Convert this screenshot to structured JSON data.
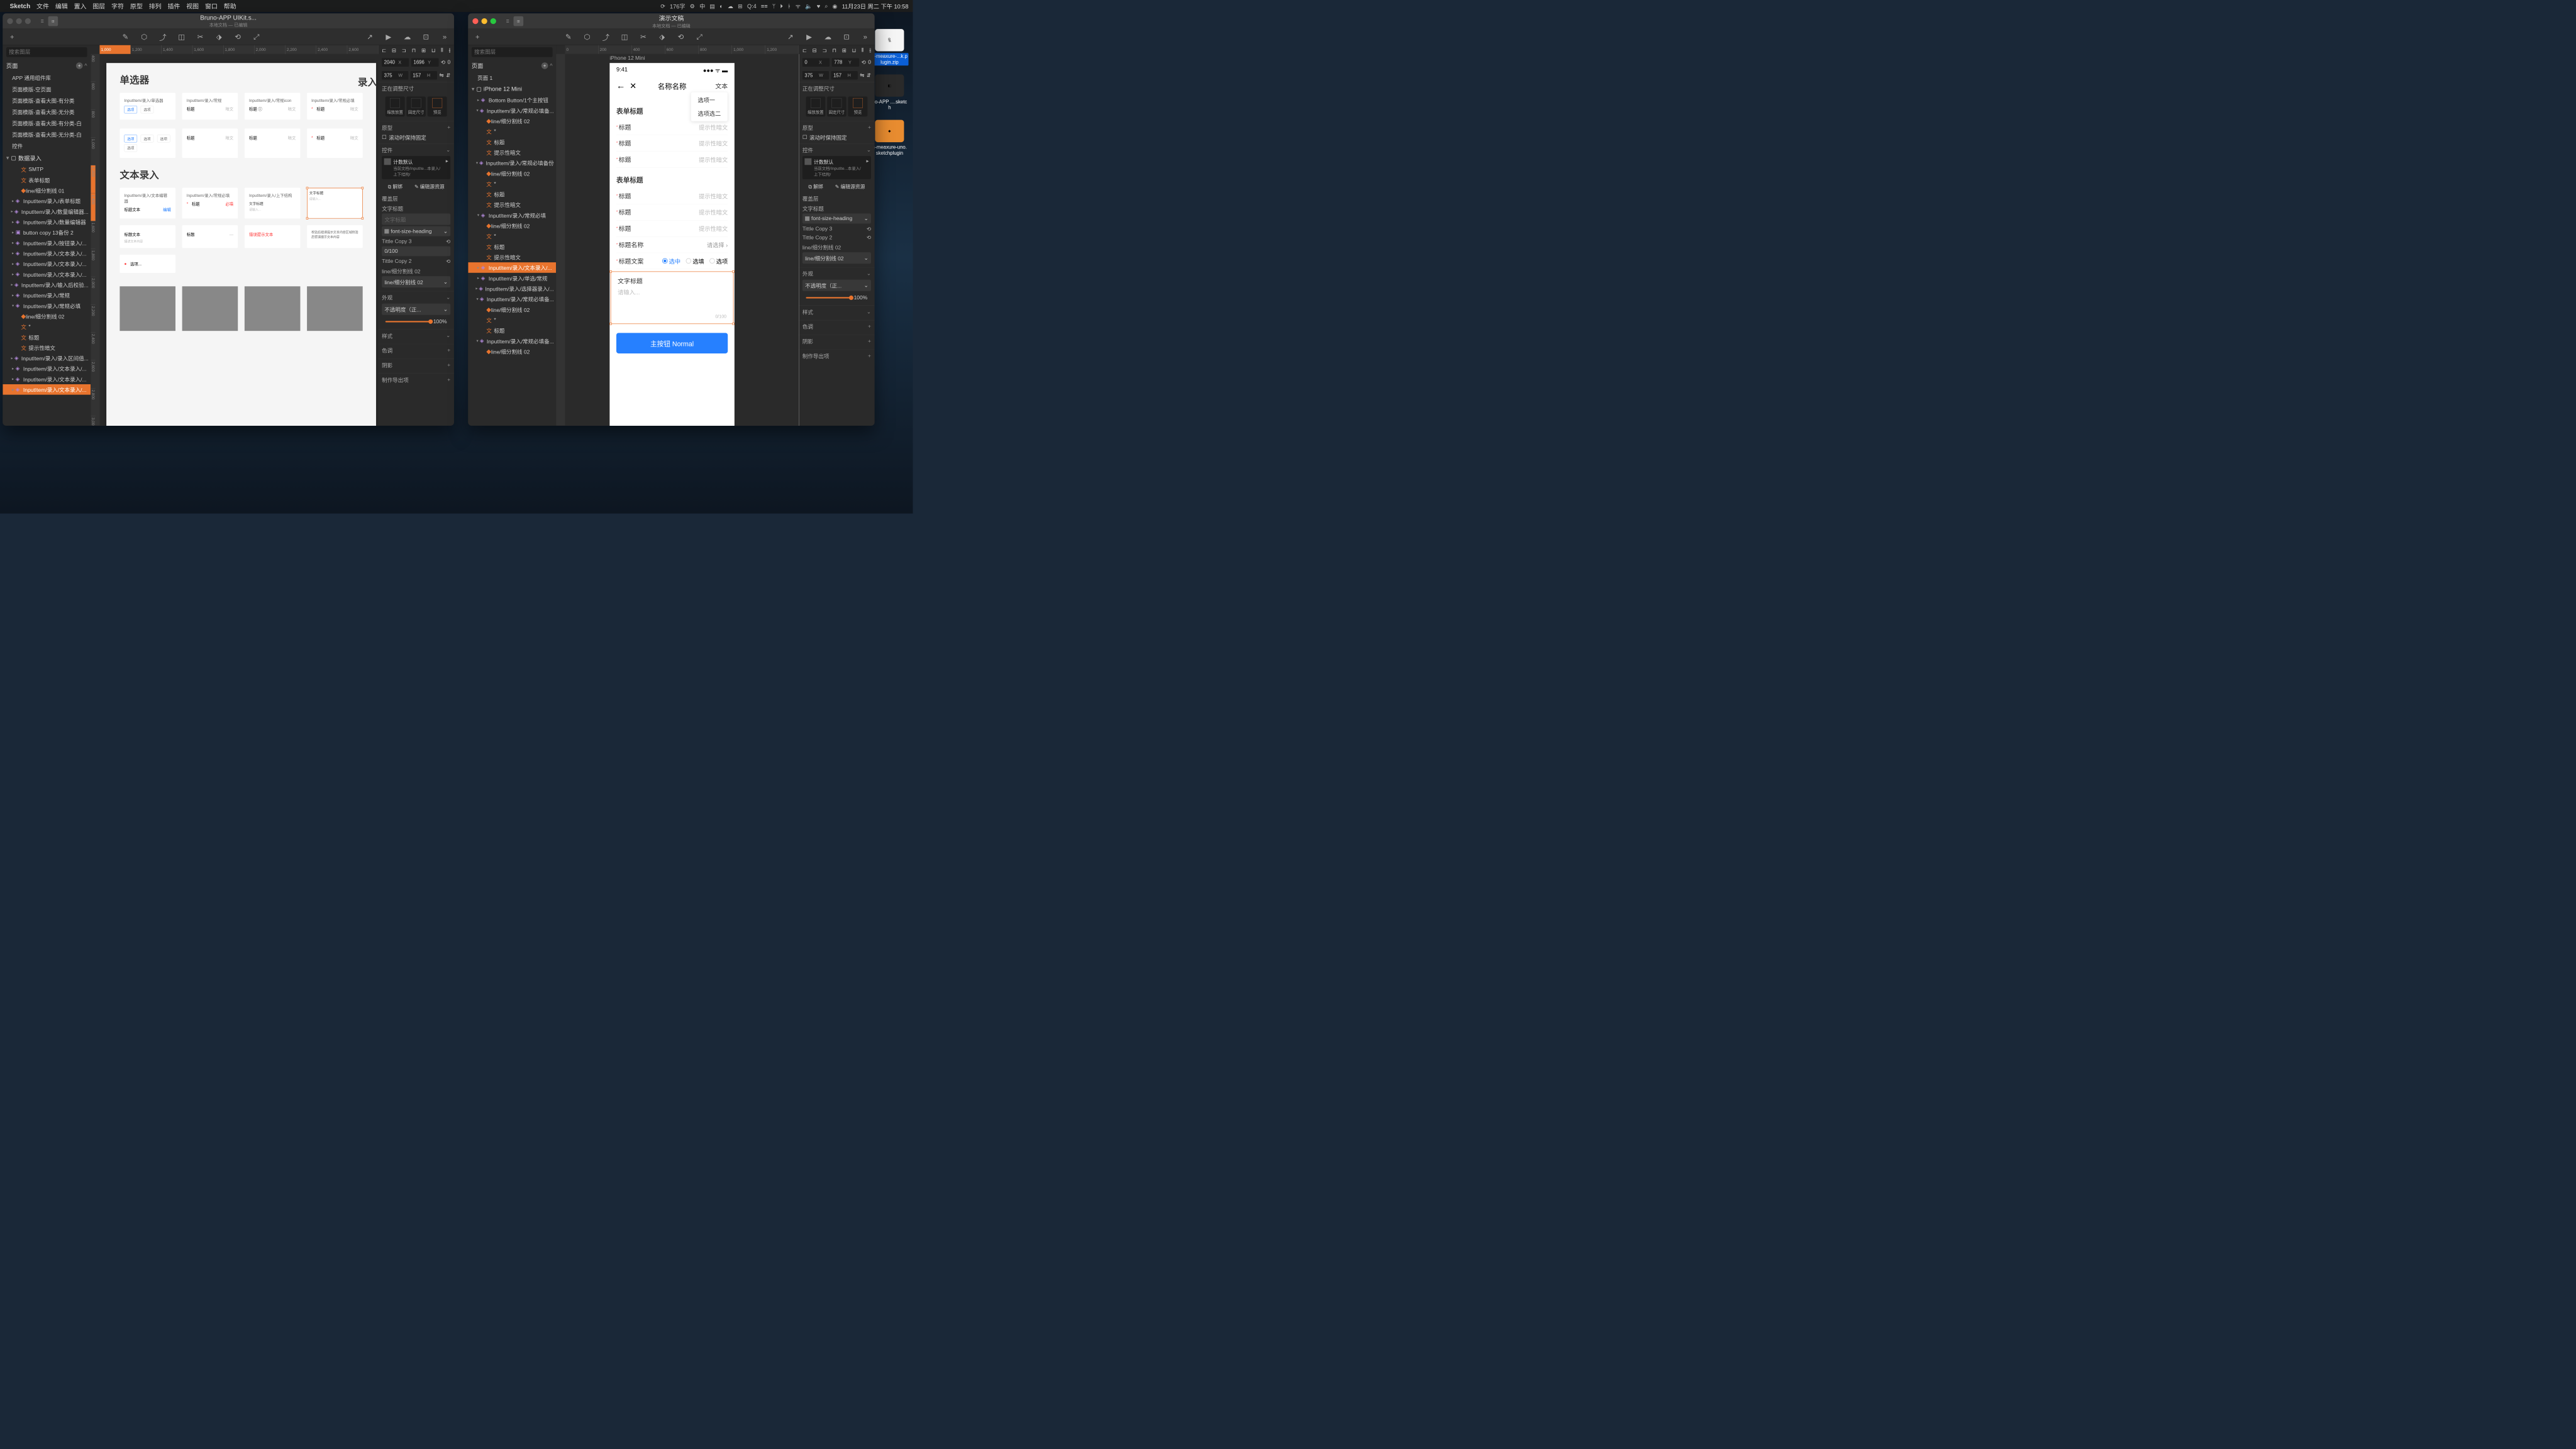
{
  "menubar": {
    "app": "Sketch",
    "items": [
      "文件",
      "编辑",
      "置入",
      "图层",
      "字符",
      "原型",
      "排列",
      "插件",
      "视图",
      "窗口",
      "帮助"
    ],
    "right": {
      "input_stat": "176字",
      "icons": [
        "⟳",
        "⚙",
        "中",
        "☰",
        "▣",
        "☁",
        "⊞",
        "Q:4",
        "≡",
        "ᛘ",
        "⏏",
        "⚡",
        "✶",
        "⊙",
        "ᯤ",
        "🔈",
        "♥",
        "⌕"
      ],
      "date": "11月23日 周二 下午 10:58"
    }
  },
  "desktop_icons": [
    {
      "name": "n-meaxure-...k.plugin.zip"
    },
    {
      "name": "no-APP ....sketch"
    },
    {
      "name": "n-meaxure-uno.sketchplugin"
    }
  ],
  "window_left": {
    "title": "Bruno-APP UIKit.s...",
    "subtitle": "本地文档 — 已编辑",
    "sidebar": {
      "search_ph": "搜索图层",
      "pages_head": "页面",
      "pages": [
        "APP 通用组件库",
        "页面模版-空页面",
        "页面模版-查看大图-有分类",
        "页面模版-查看大图-无分类",
        "页面模版-查看大图-有分类-白",
        "页面模版-查看大图-无分类-白",
        "控件"
      ],
      "layers_head": "数据录入",
      "layers": [
        {
          "t": "SMTP",
          "d": 2,
          "ic": "txt"
        },
        {
          "t": "表单标题",
          "d": 2,
          "ic": "txt"
        },
        {
          "t": "line/细分割线 01",
          "d": 2,
          "ic": "dot"
        },
        {
          "t": "InputItem/录入/表单标题",
          "d": 1,
          "ic": "sym",
          "chev": "▸"
        },
        {
          "t": "InputItem/录入/数量编辑器...",
          "d": 1,
          "ic": "sym",
          "chev": "▸"
        },
        {
          "t": "InputItem/录入/数量编辑器",
          "d": 1,
          "ic": "sym",
          "chev": "▸"
        },
        {
          "t": "button copy 13备份 2",
          "d": 1,
          "ic": "grp",
          "chev": "▸"
        },
        {
          "t": "InputItem/录入/按钮录入/...",
          "d": 1,
          "ic": "sym",
          "chev": "▸"
        },
        {
          "t": "InputItem/录入/文本录入/...",
          "d": 1,
          "ic": "sym",
          "chev": "▸"
        },
        {
          "t": "InputItem/录入/文本录入/...",
          "d": 1,
          "ic": "sym",
          "chev": "▸"
        },
        {
          "t": "InputItem/录入/文本录入/...",
          "d": 1,
          "ic": "sym",
          "chev": "▸"
        },
        {
          "t": "InputItem/录入/输入后校验...",
          "d": 1,
          "ic": "sym",
          "chev": "▸"
        },
        {
          "t": "InputItem/录入/常规",
          "d": 1,
          "ic": "sym",
          "chev": "▸"
        },
        {
          "t": "InputItem/录入/常规必填",
          "d": 1,
          "ic": "sym",
          "chev": "▾"
        },
        {
          "t": "line/细分割线 02",
          "d": 2,
          "ic": "dot"
        },
        {
          "t": "*",
          "d": 2,
          "ic": "txt"
        },
        {
          "t": "标题",
          "d": 2,
          "ic": "txt"
        },
        {
          "t": "提示性暗文",
          "d": 2,
          "ic": "txt"
        },
        {
          "t": "InputItem/录入/录入区间值...",
          "d": 1,
          "ic": "sym",
          "chev": "▸"
        },
        {
          "t": "InputItem/录入/文本录入/...",
          "d": 1,
          "ic": "sym",
          "chev": "▸"
        },
        {
          "t": "InputItem/录入/文本录入/...",
          "d": 1,
          "ic": "sym",
          "chev": "▸"
        },
        {
          "t": "InputItem/录入/文本录入/...",
          "d": 1,
          "ic": "sym",
          "chev": "▸",
          "sel": true
        }
      ]
    },
    "ruler_h": [
      "1,000",
      "1,200",
      "1,400",
      "1,600",
      "1,800",
      "2,000",
      "2,200",
      "2,400",
      "2,600"
    ],
    "ruler_v": [
      "400",
      "600",
      "800",
      "1,000",
      "1,200",
      "1,400",
      "1,600",
      "1,800",
      "2,000",
      "2,200",
      "2,400",
      "2,600",
      "2,800",
      "3,000"
    ],
    "artboard": {
      "sec1": "单选器",
      "sec1b": "录入卡",
      "sec2": "文本录入",
      "caps": [
        "InputItem/录入/单选器",
        "InputItem/录入/常规",
        "InputItem/录入/常规icon",
        "InputItem/录入/常规必填"
      ],
      "txt_caps": [
        "InputItem/录入/文本编辑器",
        "InputItem/录入/常规必填",
        "InputItem/录入/上下结构"
      ]
    },
    "inspector": {
      "x": "2040",
      "y": "1696",
      "w": "375",
      "h": "157",
      "rot": "0",
      "resize_label": "正在调整尺寸",
      "align_labels": [
        "缩放放置",
        "固定尺寸",
        "预览"
      ],
      "type_label": "原型",
      "scroll_fix": "滚动时保持固定",
      "overrides_label": "控件",
      "ov_name": "计数默认",
      "ov_path": "当前文档/InputIte...本录入/上下结构/",
      "detach": "解绑",
      "edit_src": "编辑源资源",
      "cover": "覆盖层",
      "txt_title": "文字标题",
      "txt_title_ph": "文字标题",
      "heading": "font-size-heading",
      "tc3": "Tittle Copy 3",
      "tc3_val": "0/100",
      "tc2": "Tittle Copy 2",
      "line": "line/细分割线 02",
      "line_val": "line/细分割线 02",
      "appearance": "外观",
      "opacity_label": "不透明度（正...",
      "opacity_val": "100%",
      "style": "样式",
      "tint": "色调",
      "shadow": "阴影",
      "export": "制作导出项"
    }
  },
  "window_right": {
    "title": "演示文稿",
    "subtitle": "本地文档 — 已编辑",
    "sidebar": {
      "search_ph": "搜索图层",
      "pages_head": "页面",
      "pages": [
        "页面 1"
      ],
      "artboard": "iPhone 12 Mini",
      "layers": [
        {
          "t": "Bottom Button/1个主按钮",
          "d": 1,
          "ic": "sym",
          "chev": "▸"
        },
        {
          "t": "InputItem/录入/常规必填备...",
          "d": 1,
          "ic": "sym",
          "chev": "▾"
        },
        {
          "t": "line/细分割线 02",
          "d": 2,
          "ic": "dot"
        },
        {
          "t": "*",
          "d": 2,
          "ic": "txt"
        },
        {
          "t": "标题",
          "d": 2,
          "ic": "txt"
        },
        {
          "t": "提示性暗文",
          "d": 2,
          "ic": "txt"
        },
        {
          "t": "InputItem/录入/常规必填备份",
          "d": 1,
          "ic": "sym",
          "chev": "▾"
        },
        {
          "t": "line/细分割线 02",
          "d": 2,
          "ic": "dot"
        },
        {
          "t": "*",
          "d": 2,
          "ic": "txt"
        },
        {
          "t": "标题",
          "d": 2,
          "ic": "txt"
        },
        {
          "t": "提示性暗文",
          "d": 2,
          "ic": "txt"
        },
        {
          "t": "InputItem/录入/常规必填",
          "d": 1,
          "ic": "sym",
          "chev": "▾"
        },
        {
          "t": "line/细分割线 02",
          "d": 2,
          "ic": "dot"
        },
        {
          "t": "*",
          "d": 2,
          "ic": "txt"
        },
        {
          "t": "标题",
          "d": 2,
          "ic": "txt"
        },
        {
          "t": "提示性暗文",
          "d": 2,
          "ic": "txt"
        },
        {
          "t": "InputItem/录入/文本录入/...",
          "d": 1,
          "ic": "sym",
          "chev": "▸",
          "sel": true
        },
        {
          "t": "InputItem/录入/单选/常规",
          "d": 1,
          "ic": "sym",
          "chev": "▸"
        },
        {
          "t": "InputItem/录入/选择器录入/...",
          "d": 1,
          "ic": "sym",
          "chev": "▸"
        },
        {
          "t": "InputItem/录入/常规必填备...",
          "d": 1,
          "ic": "sym",
          "chev": "▾"
        },
        {
          "t": "line/细分割线 02",
          "d": 2,
          "ic": "dot"
        },
        {
          "t": "*",
          "d": 2,
          "ic": "txt"
        },
        {
          "t": "标题",
          "d": 2,
          "ic": "txt"
        },
        {
          "t": "InputItem/录入/常规必填备...",
          "d": 1,
          "ic": "sym",
          "chev": "▾"
        },
        {
          "t": "line/细分割线 02",
          "d": 2,
          "ic": "dot"
        }
      ]
    },
    "ruler_h": [
      "0",
      "200",
      "400",
      "600",
      "800",
      "1,000",
      "1,200"
    ],
    "iphone": {
      "time": "9:41",
      "signal": "●●● ᯤ ▬",
      "nav_title": "名称名称",
      "nav_act": "文本",
      "dropdown": [
        "选项一",
        "选项选二"
      ],
      "sec1": "表单标题",
      "rows1": [
        {
          "l": "标题",
          "h": "提示性暗文"
        },
        {
          "l": "标题",
          "h": "提示性暗文"
        },
        {
          "l": "标题",
          "h": "提示性暗文"
        }
      ],
      "sec2": "表单标题",
      "rows2": [
        {
          "l": "标题",
          "h": "提示性暗文"
        },
        {
          "l": "标题",
          "h": "提示性暗文"
        },
        {
          "l": "标题",
          "h": "提示性暗文"
        },
        {
          "l": "标题名称",
          "h": "请选择 ›"
        }
      ],
      "radio_label": "标题文案",
      "radios": [
        "选中",
        "选填",
        "选项"
      ],
      "ta_title": "文字标题",
      "ta_ph": "请输入...",
      "ta_count": "0/100",
      "btn": "主按钮 Normal"
    },
    "inspector": {
      "x": "0",
      "y": "778",
      "w": "375",
      "h": "157",
      "rot": "0",
      "resize_label": "正在调整尺寸",
      "align_labels": [
        "缩放放置",
        "固定尺寸",
        "预览"
      ],
      "type_label": "原型",
      "scroll_fix": "滚动时保持固定",
      "overrides_label": "控件",
      "ov_name": "计数默认",
      "ov_path": "当前文档/InputIte...本录入/上下结构/",
      "detach": "解绑",
      "edit_src": "编辑源资源",
      "cover": "覆盖层",
      "txt_title": "文字标题",
      "heading": "font-size-heading",
      "tc3": "Tittle Copy 3",
      "tc2": "Tittle Copy 2",
      "line": "line/细分割线 02",
      "line_val": "line/细分割线 02",
      "appearance": "外观",
      "opacity_label": "不透明度（正...",
      "opacity_val": "100%",
      "style": "样式",
      "tint": "色调",
      "shadow": "阴影",
      "export": "制作导出项"
    }
  }
}
